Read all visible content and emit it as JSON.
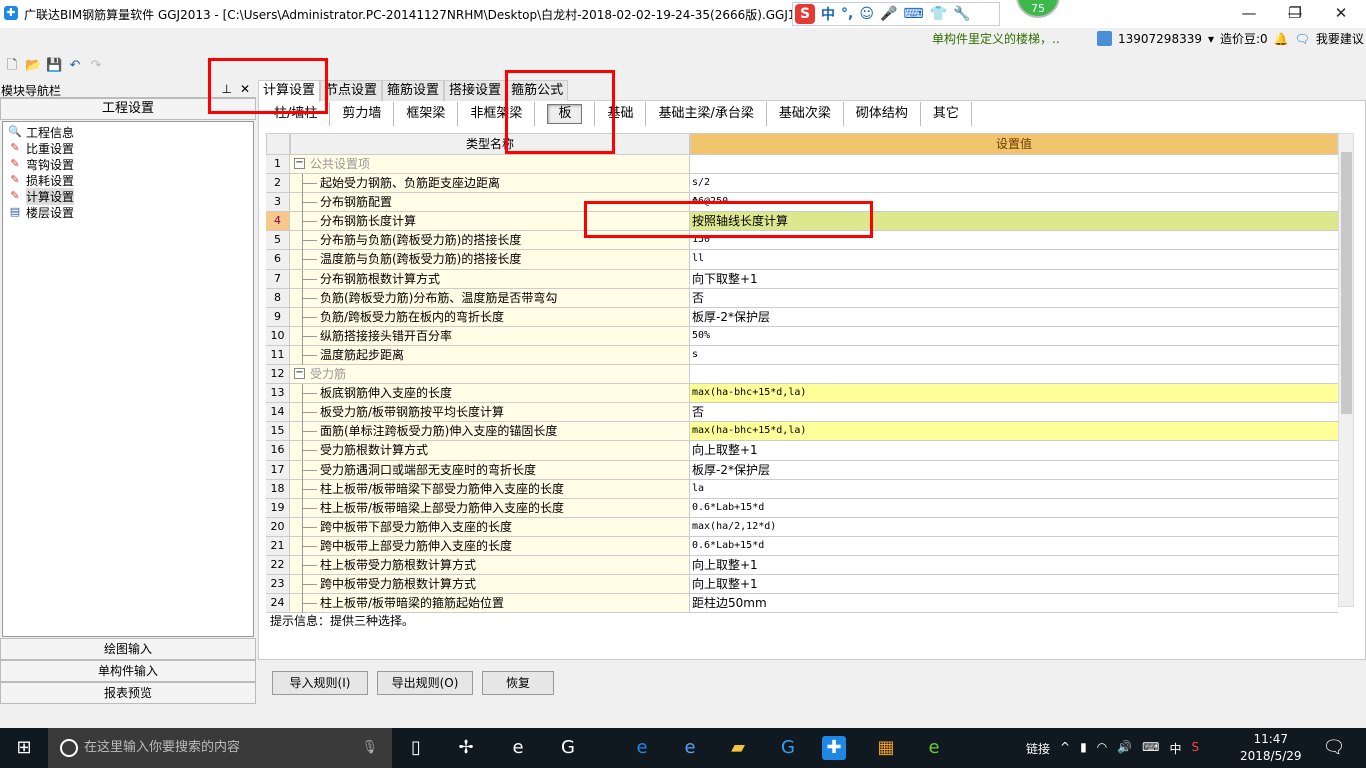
{
  "window": {
    "title": "广联达BIM钢筋算量软件 GGJ2013 - [C:\\Users\\Administrator.PC-20141127NRHM\\Desktop\\白龙村-2018-02-02-19-24-35(2666版).GGJ12]",
    "minimize": "—",
    "maximize": "❐",
    "close": "✕"
  },
  "ime": {
    "brand": "S",
    "mode": "中",
    "punct": "°,",
    "items": [
      "☺",
      "🎤",
      "⌨",
      "👕",
      "🔧"
    ]
  },
  "badge": "75",
  "notice": "单构件里定义的楼梯，..",
  "user": {
    "phone": "13907298339",
    "beans": "造价豆:0",
    "suggest": "我要建议"
  },
  "nav": {
    "title": "模块导航栏",
    "section": "工程设置",
    "items": [
      {
        "label": "工程信息",
        "icon": "info-icon"
      },
      {
        "label": "比重设置",
        "icon": "weight-icon"
      },
      {
        "label": "弯钩设置",
        "icon": "hook-icon"
      },
      {
        "label": "损耗设置",
        "icon": "loss-icon"
      },
      {
        "label": "计算设置",
        "icon": "calc-icon",
        "selected": true
      },
      {
        "label": "楼层设置",
        "icon": "floor-icon"
      }
    ],
    "bottom": [
      "绘图输入",
      "单构件输入",
      "报表预览"
    ]
  },
  "tabs": [
    "计算设置",
    "节点设置",
    "箍筋设置",
    "搭接设置",
    "箍筋公式"
  ],
  "active_tab": "计算设置",
  "subtabs": [
    "柱/墙柱",
    "剪力墙",
    "框架梁",
    "非框架梁",
    "板",
    "基础",
    "基础主梁/承台梁",
    "基础次梁",
    "砌体结构",
    "其它"
  ],
  "active_subtab": "板",
  "grid": {
    "col_name": "类型名称",
    "col_value": "设置值",
    "rows": [
      {
        "n": "1",
        "label": "公共设置项",
        "value": "",
        "group": true
      },
      {
        "n": "2",
        "label": "起始受力钢筋、负筋距支座边距离",
        "value": "s/2"
      },
      {
        "n": "3",
        "label": "分布钢筋配置",
        "value": "Φ6@250"
      },
      {
        "n": "4",
        "label": "分布钢筋长度计算",
        "value": "按照轴线长度计算",
        "current": true
      },
      {
        "n": "5",
        "label": "分布筋与负筋(跨板受力筋)的搭接长度",
        "value": "150"
      },
      {
        "n": "6",
        "label": "温度筋与负筋(跨板受力筋)的搭接长度",
        "value": "ll"
      },
      {
        "n": "7",
        "label": "分布钢筋根数计算方式",
        "value": "向下取整+1"
      },
      {
        "n": "8",
        "label": "负筋(跨板受力筋)分布筋、温度筋是否带弯勾",
        "value": "否"
      },
      {
        "n": "9",
        "label": "负筋/跨板受力筋在板内的弯折长度",
        "value": "板厚-2*保护层"
      },
      {
        "n": "10",
        "label": "纵筋搭接接头错开百分率",
        "value": "50%"
      },
      {
        "n": "11",
        "label": "温度筋起步距离",
        "value": "s"
      },
      {
        "n": "12",
        "label": "受力筋",
        "value": "",
        "group": true
      },
      {
        "n": "13",
        "label": "板底钢筋伸入支座的长度",
        "value": "max(ha-bhc+15*d,la)",
        "highlight": true
      },
      {
        "n": "14",
        "label": "板受力筋/板带钢筋按平均长度计算",
        "value": "否"
      },
      {
        "n": "15",
        "label": "面筋(单标注跨板受力筋)伸入支座的锚固长度",
        "value": "max(ha-bhc+15*d,la)",
        "highlight": true
      },
      {
        "n": "16",
        "label": "受力筋根数计算方式",
        "value": "向上取整+1"
      },
      {
        "n": "17",
        "label": "受力筋遇洞口或端部无支座时的弯折长度",
        "value": "板厚-2*保护层"
      },
      {
        "n": "18",
        "label": "柱上板带/板带暗梁下部受力筋伸入支座的长度",
        "value": "la"
      },
      {
        "n": "19",
        "label": "柱上板带/板带暗梁上部受力筋伸入支座的长度",
        "value": "0.6*Lab+15*d"
      },
      {
        "n": "20",
        "label": "跨中板带下部受力筋伸入支座的长度",
        "value": "max(ha/2,12*d)"
      },
      {
        "n": "21",
        "label": "跨中板带上部受力筋伸入支座的长度",
        "value": "0.6*Lab+15*d"
      },
      {
        "n": "22",
        "label": "柱上板带受力筋根数计算方式",
        "value": "向上取整+1"
      },
      {
        "n": "23",
        "label": "跨中板带受力筋根数计算方式",
        "value": "向上取整+1"
      },
      {
        "n": "24",
        "label": "柱上板带/板带暗梁的箍筋起始位置",
        "value": "距柱边50mm"
      }
    ]
  },
  "hint": "提示信息：提供三种选择。",
  "buttons": {
    "import": "导入规则(I)",
    "export": "导出规则(O)",
    "restore": "恢复"
  },
  "taskbar": {
    "search_placeholder": "在这里输入你要搜索的内容",
    "links": "链接",
    "lang": "中",
    "time": "11:47",
    "date": "2018/5/29"
  },
  "colors": {
    "header": "#f2c46d",
    "current_value": "#dde88e",
    "highlight_value": "#ffff99",
    "annotation": "#ff0000"
  }
}
